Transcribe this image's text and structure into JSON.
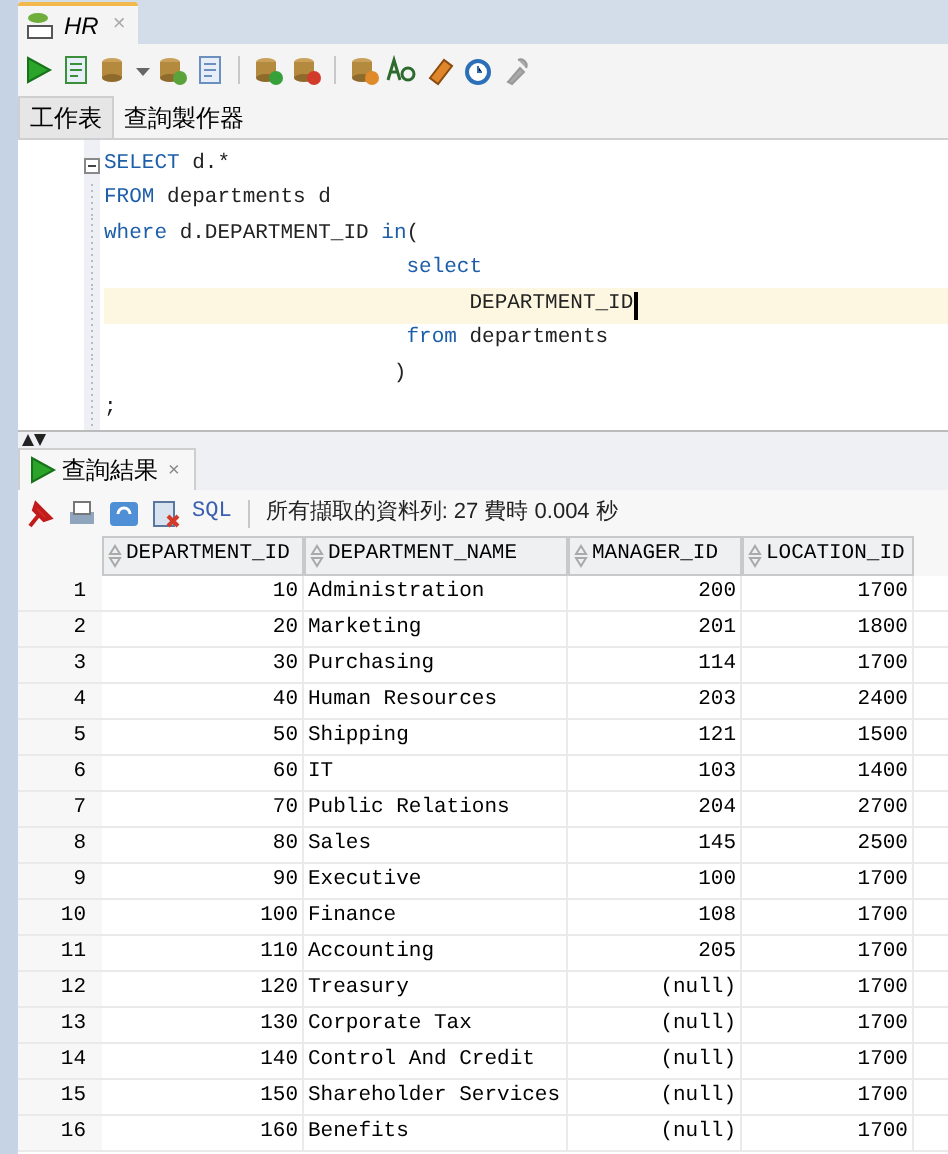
{
  "document_tab": {
    "label": "HR",
    "close": "×"
  },
  "subtabs": [
    {
      "label": "工作表",
      "selected": true
    },
    {
      "label": "查詢製作器",
      "selected": false
    }
  ],
  "editor": {
    "lines": [
      {
        "foldable": true,
        "current": false,
        "tokens": [
          {
            "kind": "keyword",
            "text": "SELECT"
          },
          {
            "kind": "plain",
            "text": " d.*"
          }
        ]
      },
      {
        "foldable": false,
        "current": false,
        "tokens": [
          {
            "kind": "keyword",
            "text": "FROM"
          },
          {
            "kind": "plain",
            "text": " departments d"
          }
        ]
      },
      {
        "foldable": false,
        "current": false,
        "tokens": [
          {
            "kind": "keyword",
            "text": "where"
          },
          {
            "kind": "plain",
            "text": " d.DEPARTMENT_ID "
          },
          {
            "kind": "keyword",
            "text": "in"
          },
          {
            "kind": "plain",
            "text": "("
          }
        ]
      },
      {
        "foldable": false,
        "current": false,
        "tokens": [
          {
            "kind": "keyword",
            "text": "                        select"
          }
        ]
      },
      {
        "foldable": false,
        "current": true,
        "tokens": [
          {
            "kind": "plain",
            "text": "                             DEPARTMENT_ID"
          }
        ]
      },
      {
        "foldable": false,
        "current": false,
        "tokens": [
          {
            "kind": "keyword",
            "text": "                        from"
          },
          {
            "kind": "plain",
            "text": " departments"
          }
        ]
      },
      {
        "foldable": false,
        "current": false,
        "tokens": [
          {
            "kind": "plain",
            "text": "                       )"
          }
        ]
      },
      {
        "foldable": false,
        "current": false,
        "tokens": [
          {
            "kind": "plain",
            "text": ";"
          }
        ]
      }
    ]
  },
  "results_tab": {
    "label": "查詢結果",
    "close": "×"
  },
  "results_toolbar": {
    "sql_link": "SQL",
    "status": "所有擷取的資料列: 27 費時 0.004 秒"
  },
  "table": {
    "columns": [
      "DEPARTMENT_ID",
      "DEPARTMENT_NAME",
      "MANAGER_ID",
      "LOCATION_ID"
    ],
    "rows": [
      {
        "number": "1",
        "cells": [
          "10",
          "Administration",
          "200",
          "1700"
        ]
      },
      {
        "number": "2",
        "cells": [
          "20",
          "Marketing",
          "201",
          "1800"
        ]
      },
      {
        "number": "3",
        "cells": [
          "30",
          "Purchasing",
          "114",
          "1700"
        ]
      },
      {
        "number": "4",
        "cells": [
          "40",
          "Human Resources",
          "203",
          "2400"
        ]
      },
      {
        "number": "5",
        "cells": [
          "50",
          "Shipping",
          "121",
          "1500"
        ]
      },
      {
        "number": "6",
        "cells": [
          "60",
          "IT",
          "103",
          "1400"
        ]
      },
      {
        "number": "7",
        "cells": [
          "70",
          "Public Relations",
          "204",
          "2700"
        ]
      },
      {
        "number": "8",
        "cells": [
          "80",
          "Sales",
          "145",
          "2500"
        ]
      },
      {
        "number": "9",
        "cells": [
          "90",
          "Executive",
          "100",
          "1700"
        ]
      },
      {
        "number": "10",
        "cells": [
          "100",
          "Finance",
          "108",
          "1700"
        ]
      },
      {
        "number": "11",
        "cells": [
          "110",
          "Accounting",
          "205",
          "1700"
        ]
      },
      {
        "number": "12",
        "cells": [
          "120",
          "Treasury",
          "(null)",
          "1700"
        ]
      },
      {
        "number": "13",
        "cells": [
          "130",
          "Corporate Tax",
          "(null)",
          "1700"
        ]
      },
      {
        "number": "14",
        "cells": [
          "140",
          "Control And Credit",
          "(null)",
          "1700"
        ]
      },
      {
        "number": "15",
        "cells": [
          "150",
          "Shareholder Services",
          "(null)",
          "1700"
        ]
      },
      {
        "number": "16",
        "cells": [
          "160",
          "Benefits",
          "(null)",
          "1700"
        ]
      }
    ]
  }
}
